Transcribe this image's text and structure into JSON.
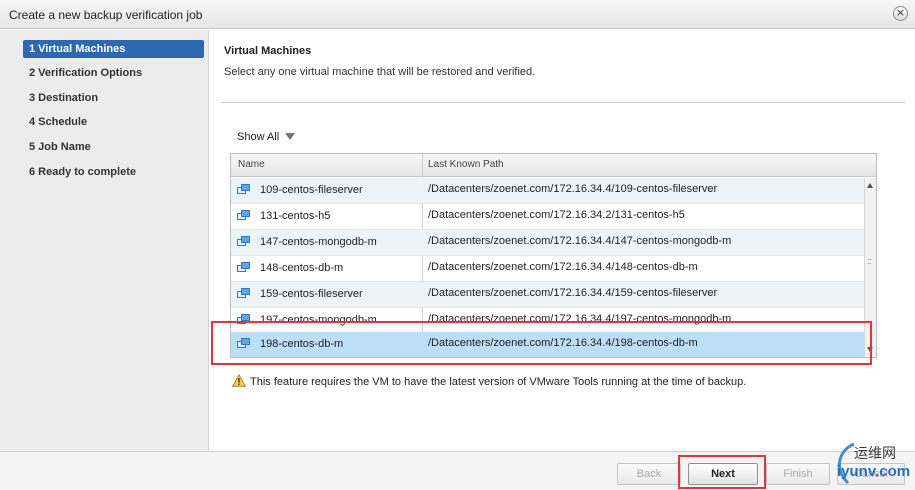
{
  "window": {
    "title": "Create a new backup verification job"
  },
  "sidebar": {
    "steps": [
      {
        "label": "1  Virtual Machines",
        "active": true
      },
      {
        "label": "2  Verification Options",
        "active": false
      },
      {
        "label": "3  Destination",
        "active": false
      },
      {
        "label": "4  Schedule",
        "active": false
      },
      {
        "label": "5  Job Name",
        "active": false
      },
      {
        "label": "6  Ready to complete",
        "active": false
      }
    ]
  },
  "main": {
    "title": "Virtual Machines",
    "description": "Select any one virtual machine that will be restored and verified.",
    "filter_label": "Show All",
    "grid": {
      "columns": [
        "Name",
        "Last Known Path"
      ],
      "rows": [
        {
          "name": "109-centos-fileserver",
          "path": "/Datacenters/zoenet.com/172.16.34.4/109-centos-fileserver"
        },
        {
          "name": "131-centos-h5",
          "path": "/Datacenters/zoenet.com/172.16.34.2/131-centos-h5"
        },
        {
          "name": "147-centos-mongodb-m",
          "path": "/Datacenters/zoenet.com/172.16.34.4/147-centos-mongodb-m"
        },
        {
          "name": "148-centos-db-m",
          "path": "/Datacenters/zoenet.com/172.16.34.4/148-centos-db-m"
        },
        {
          "name": "159-centos-fileserver",
          "path": "/Datacenters/zoenet.com/172.16.34.4/159-centos-fileserver"
        },
        {
          "name": "197-centos-mongodb-m",
          "path": "/Datacenters/zoenet.com/172.16.34.4/197-centos-mongodb-m"
        },
        {
          "name": "198-centos-db-m",
          "path": "/Datacenters/zoenet.com/172.16.34.4/198-centos-db-m"
        }
      ],
      "selected_index": 6
    },
    "warning": "This feature requires the VM to have the latest version of VMware Tools running at the time of backup."
  },
  "footer": {
    "back": "Back",
    "next": "Next",
    "finish": "Finish",
    "cancel": "Cancel"
  },
  "watermark": {
    "top": "运维网",
    "bottom": "iyunv.com"
  },
  "colors": {
    "accent": "#2d69b3",
    "selected_row": "#bcdff7",
    "annotation_red": "#e0353a"
  }
}
